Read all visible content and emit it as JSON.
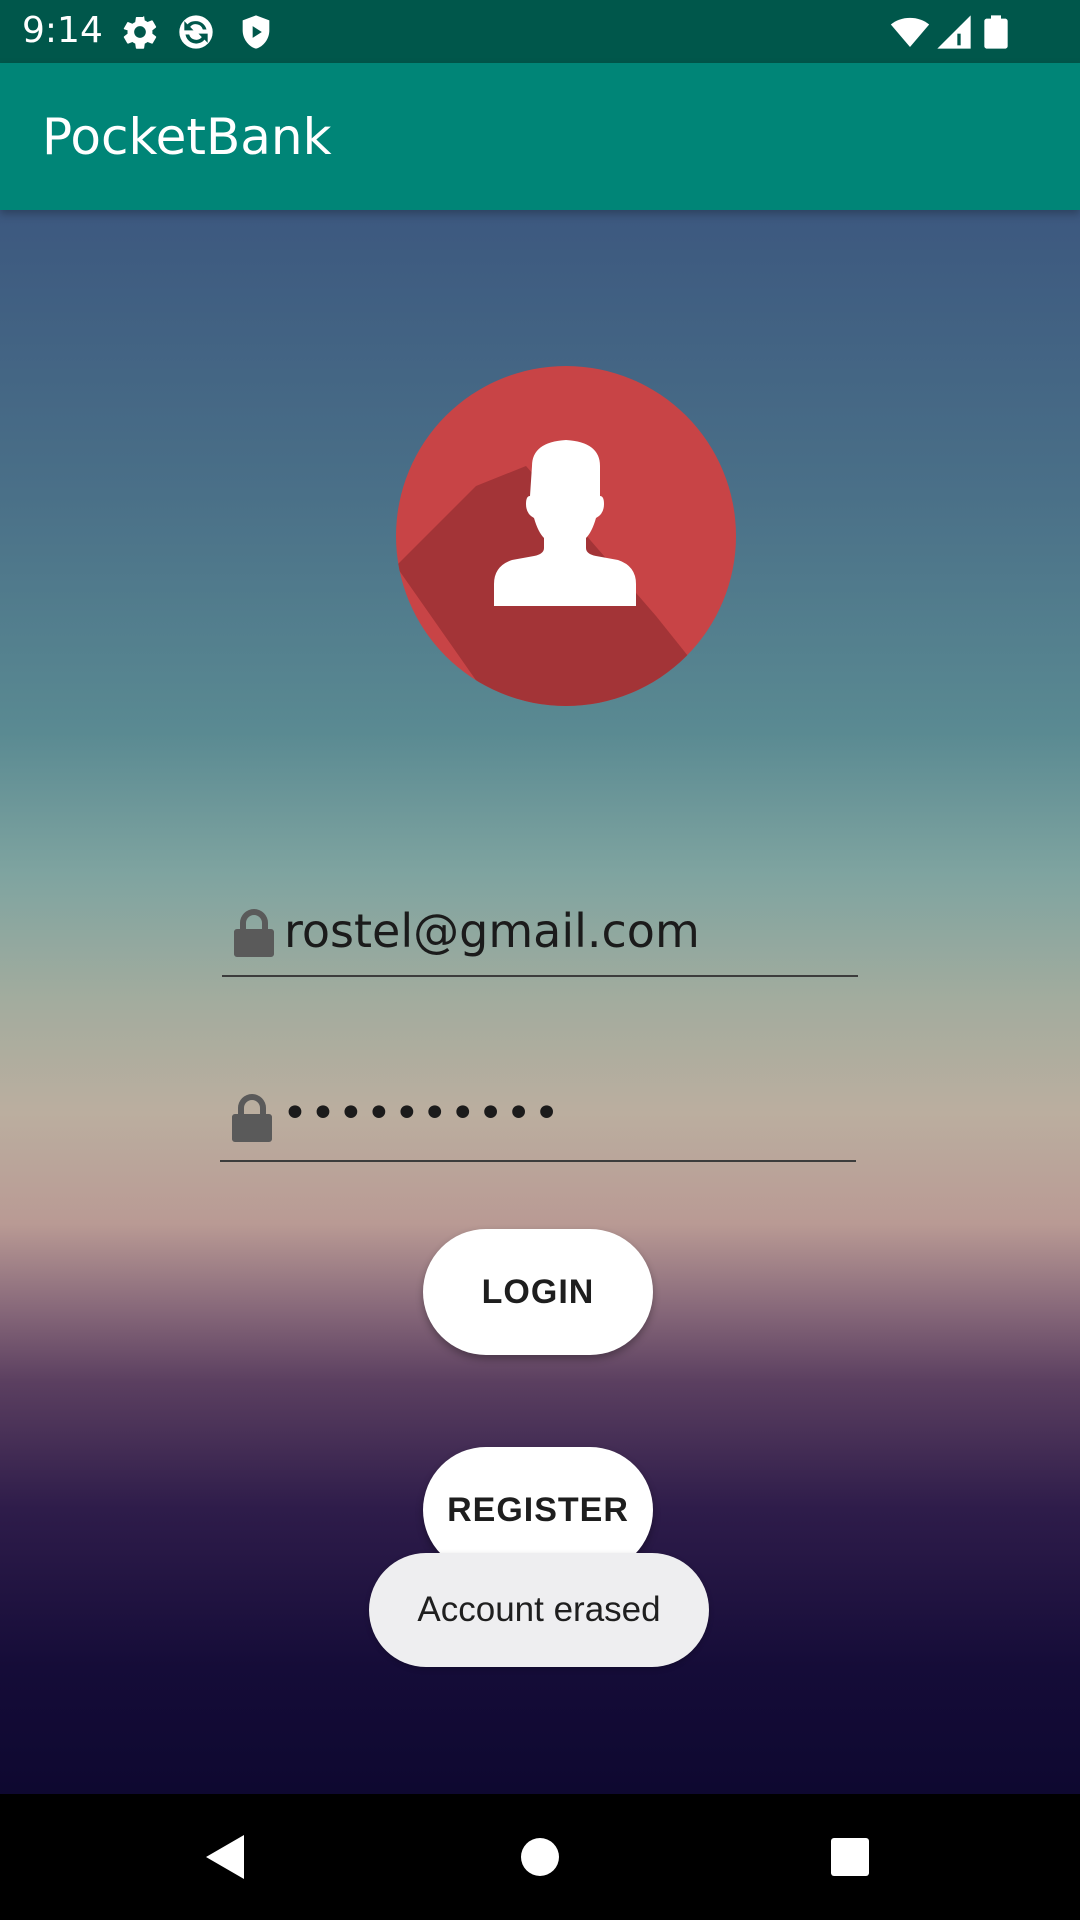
{
  "status_bar": {
    "time": "9:14",
    "icons_left": [
      "gear-icon",
      "sync-icon",
      "shield-icon"
    ],
    "icons_right": [
      "wifi-icon",
      "cell-signal-icon",
      "battery-icon"
    ]
  },
  "app_bar": {
    "title": "PocketBank",
    "background_color": "#008577"
  },
  "login_form": {
    "avatar_icon": "user-avatar-icon",
    "avatar_color": "#c84446",
    "email": {
      "icon": "lock-icon",
      "value": "rostel@gmail.com"
    },
    "password": {
      "icon": "lock-icon",
      "value": "••••••••••"
    },
    "login_label": "LOGIN",
    "register_label": "REGISTER"
  },
  "toast": {
    "message": "Account erased"
  },
  "nav_bar": {
    "items": [
      "back-icon",
      "home-icon",
      "recents-icon"
    ]
  }
}
